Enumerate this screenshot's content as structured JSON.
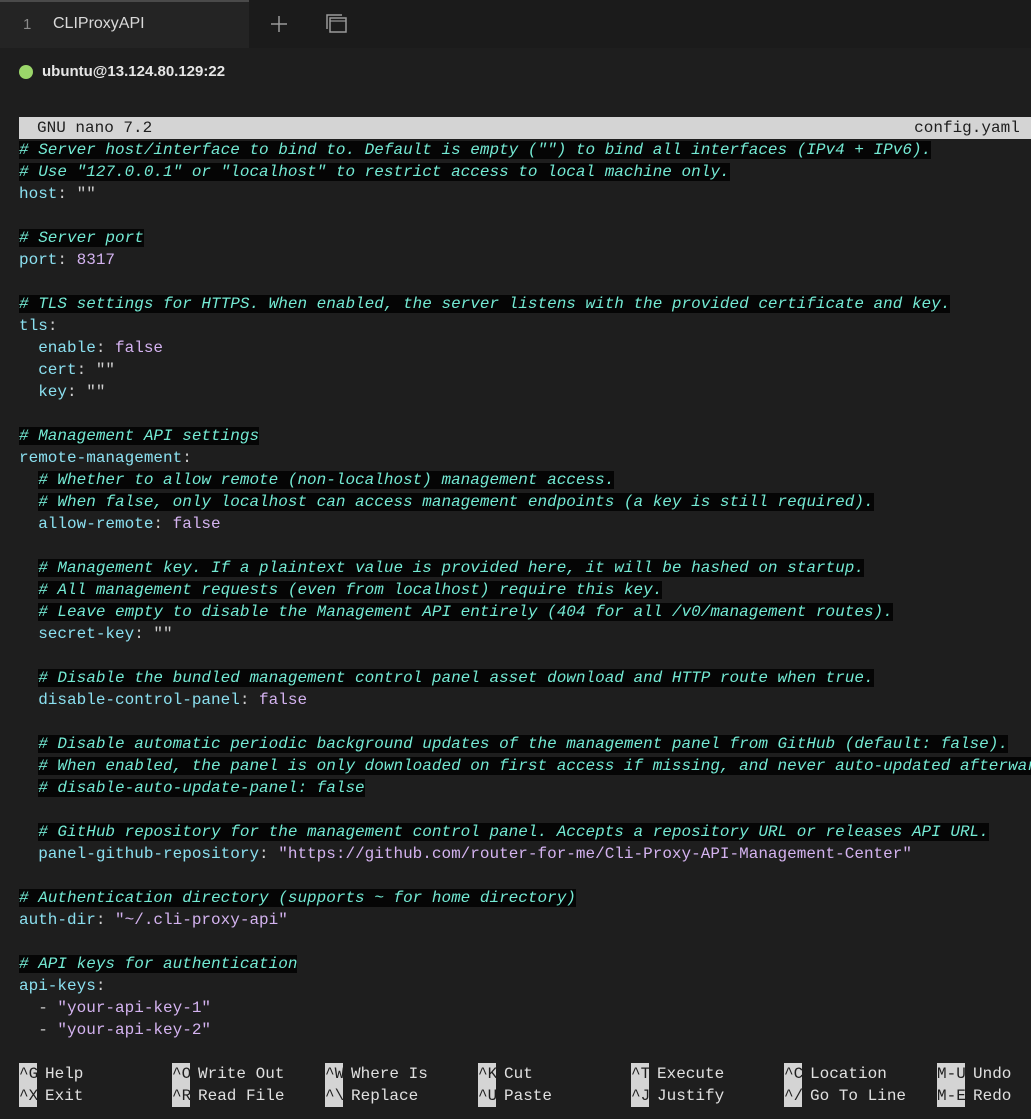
{
  "tab": {
    "index": "1",
    "title": "CLIProxyAPI"
  },
  "host": {
    "label": "ubuntu@13.124.80.129:22",
    "status_color": "#9bd66a"
  },
  "nano": {
    "version": "GNU nano 7.2",
    "filename": "config.yaml *"
  },
  "lines": [
    [
      {
        "t": "c",
        "s": "# Server host/interface to bind to. Default is empty (\"\") to bind all interfaces (IPv4 + IPv6)."
      }
    ],
    [
      {
        "t": "c",
        "s": "# Use \"127.0.0.1\" or \"localhost\" to restrict access to local machine only."
      }
    ],
    [
      {
        "t": "k",
        "s": "host"
      },
      {
        "t": "p",
        "s": ": \"\""
      }
    ],
    [],
    [
      {
        "t": "c",
        "s": "# Server port"
      }
    ],
    [
      {
        "t": "k",
        "s": "port"
      },
      {
        "t": "p",
        "s": ": "
      },
      {
        "t": "v",
        "s": "8317"
      }
    ],
    [],
    [
      {
        "t": "c",
        "s": "# TLS settings for HTTPS. When enabled, the server listens with the provided certificate and key."
      }
    ],
    [
      {
        "t": "k",
        "s": "tls"
      },
      {
        "t": "p",
        "s": ":"
      }
    ],
    [
      {
        "t": "p",
        "s": "  "
      },
      {
        "t": "k",
        "s": "enable"
      },
      {
        "t": "p",
        "s": ": "
      },
      {
        "t": "v",
        "s": "false"
      }
    ],
    [
      {
        "t": "p",
        "s": "  "
      },
      {
        "t": "k",
        "s": "cert"
      },
      {
        "t": "p",
        "s": ": \"\""
      }
    ],
    [
      {
        "t": "p",
        "s": "  "
      },
      {
        "t": "k",
        "s": "key"
      },
      {
        "t": "p",
        "s": ": \"\""
      }
    ],
    [],
    [
      {
        "t": "c",
        "s": "# Management API settings"
      }
    ],
    [
      {
        "t": "k",
        "s": "remote-management"
      },
      {
        "t": "p",
        "s": ":"
      }
    ],
    [
      {
        "t": "p",
        "s": "  "
      },
      {
        "t": "c",
        "s": "# Whether to allow remote (non-localhost) management access."
      }
    ],
    [
      {
        "t": "p",
        "s": "  "
      },
      {
        "t": "c",
        "s": "# When false, only localhost can access management endpoints (a key is still required)."
      }
    ],
    [
      {
        "t": "p",
        "s": "  "
      },
      {
        "t": "k",
        "s": "allow-remote"
      },
      {
        "t": "p",
        "s": ": "
      },
      {
        "t": "v",
        "s": "false"
      }
    ],
    [],
    [
      {
        "t": "p",
        "s": "  "
      },
      {
        "t": "c",
        "s": "# Management key. If a plaintext value is provided here, it will be hashed on startup."
      }
    ],
    [
      {
        "t": "p",
        "s": "  "
      },
      {
        "t": "c",
        "s": "# All management requests (even from localhost) require this key."
      }
    ],
    [
      {
        "t": "p",
        "s": "  "
      },
      {
        "t": "c",
        "s": "# Leave empty to disable the Management API entirely (404 for all /v0/management routes)."
      }
    ],
    [
      {
        "t": "p",
        "s": "  "
      },
      {
        "t": "k",
        "s": "secret-key"
      },
      {
        "t": "p",
        "s": ": \"\""
      }
    ],
    [],
    [
      {
        "t": "p",
        "s": "  "
      },
      {
        "t": "c",
        "s": "# Disable the bundled management control panel asset download and HTTP route when true."
      }
    ],
    [
      {
        "t": "p",
        "s": "  "
      },
      {
        "t": "k",
        "s": "disable-control-panel"
      },
      {
        "t": "p",
        "s": ": "
      },
      {
        "t": "v",
        "s": "false"
      }
    ],
    [],
    [
      {
        "t": "p",
        "s": "  "
      },
      {
        "t": "c",
        "s": "# Disable automatic periodic background updates of the management panel from GitHub (default: false)."
      }
    ],
    [
      {
        "t": "p",
        "s": "  "
      },
      {
        "t": "c",
        "s": "# When enabled, the panel is only downloaded on first access if missing, and never auto-updated afterward."
      }
    ],
    [
      {
        "t": "p",
        "s": "  "
      },
      {
        "t": "c",
        "s": "# disable-auto-update-panel: false"
      }
    ],
    [],
    [
      {
        "t": "p",
        "s": "  "
      },
      {
        "t": "c",
        "s": "# GitHub repository for the management control panel. Accepts a repository URL or releases API URL."
      }
    ],
    [
      {
        "t": "p",
        "s": "  "
      },
      {
        "t": "k",
        "s": "panel-github-repository"
      },
      {
        "t": "p",
        "s": ": "
      },
      {
        "t": "v",
        "s": "\"https://github.com/router-for-me/Cli-Proxy-API-Management-Center\""
      }
    ],
    [],
    [
      {
        "t": "c",
        "s": "# Authentication directory (supports ~ for home directory)"
      }
    ],
    [
      {
        "t": "k",
        "s": "auth-dir"
      },
      {
        "t": "p",
        "s": ": "
      },
      {
        "t": "v",
        "s": "\"~/.cli-proxy-api\""
      }
    ],
    [],
    [
      {
        "t": "c",
        "s": "# API keys for authentication"
      }
    ],
    [
      {
        "t": "k",
        "s": "api-keys"
      },
      {
        "t": "p",
        "s": ":"
      }
    ],
    [
      {
        "t": "p",
        "s": "  - "
      },
      {
        "t": "v",
        "s": "\"your-api-key-1\""
      }
    ],
    [
      {
        "t": "p",
        "s": "  - "
      },
      {
        "t": "v",
        "s": "\"your-api-key-2\""
      }
    ]
  ],
  "shortcuts": [
    {
      "key": "^G",
      "label": "Help"
    },
    {
      "key": "^X",
      "label": "Exit"
    },
    {
      "key": "^O",
      "label": "Write Out"
    },
    {
      "key": "^R",
      "label": "Read File"
    },
    {
      "key": "^W",
      "label": "Where Is"
    },
    {
      "key": "^\\",
      "label": "Replace"
    },
    {
      "key": "^K",
      "label": "Cut"
    },
    {
      "key": "^U",
      "label": "Paste"
    },
    {
      "key": "^T",
      "label": "Execute"
    },
    {
      "key": "^J",
      "label": "Justify"
    },
    {
      "key": "^C",
      "label": "Location"
    },
    {
      "key": "^/",
      "label": "Go To Line"
    },
    {
      "key": "M-U",
      "label": "Undo"
    },
    {
      "key": "M-E",
      "label": "Redo"
    }
  ]
}
